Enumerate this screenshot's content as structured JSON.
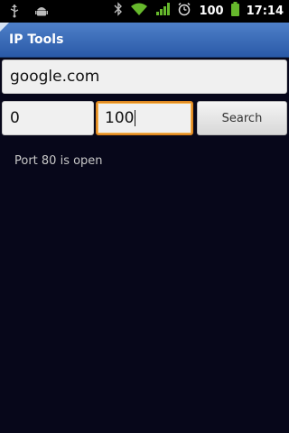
{
  "status_bar": {
    "battery_text": "100",
    "time": "17:14"
  },
  "app": {
    "title": "IP Tools"
  },
  "form": {
    "host_value": "google.com",
    "port_start_value": "0",
    "port_end_value": "100",
    "search_label": "Search"
  },
  "result": {
    "text": "Port 80 is open"
  },
  "colors": {
    "background": "#07071a",
    "title_bar": "#3a6bb8",
    "focus_border": "#e08a22"
  }
}
